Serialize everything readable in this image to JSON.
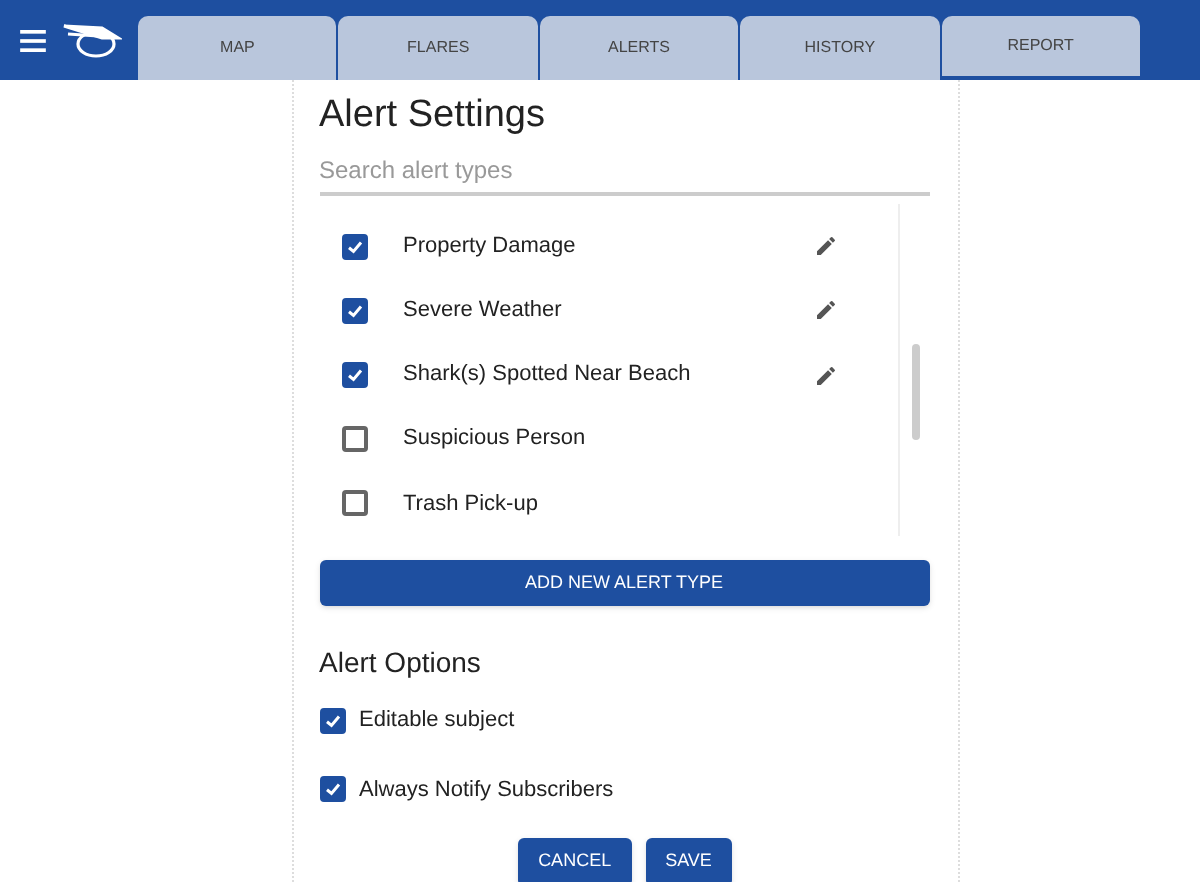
{
  "tabs": [
    {
      "label": "MAP",
      "selected": false
    },
    {
      "label": "FLARES",
      "selected": false
    },
    {
      "label": "ALERTS",
      "selected": false
    },
    {
      "label": "HISTORY",
      "selected": false
    },
    {
      "label": "REPORT",
      "selected": true
    }
  ],
  "title": "Alert Settings",
  "search": {
    "placeholder": "Search alert types"
  },
  "alert_types": [
    {
      "label": "Property Damage",
      "checked": true,
      "editable": true
    },
    {
      "label": "Severe Weather",
      "checked": true,
      "editable": true
    },
    {
      "label": "Shark(s) Spotted Near Beach",
      "checked": true,
      "editable": true
    },
    {
      "label": "Suspicious Person",
      "checked": false,
      "editable": false
    },
    {
      "label": "Trash Pick-up",
      "checked": false,
      "editable": false
    }
  ],
  "add_button": "ADD NEW ALERT TYPE",
  "options_title": "Alert Options",
  "options": [
    {
      "label": "Editable subject",
      "checked": true
    },
    {
      "label": "Always Notify Subscribers",
      "checked": true
    }
  ],
  "buttons": [
    "CANCEL",
    "SAVE"
  ]
}
